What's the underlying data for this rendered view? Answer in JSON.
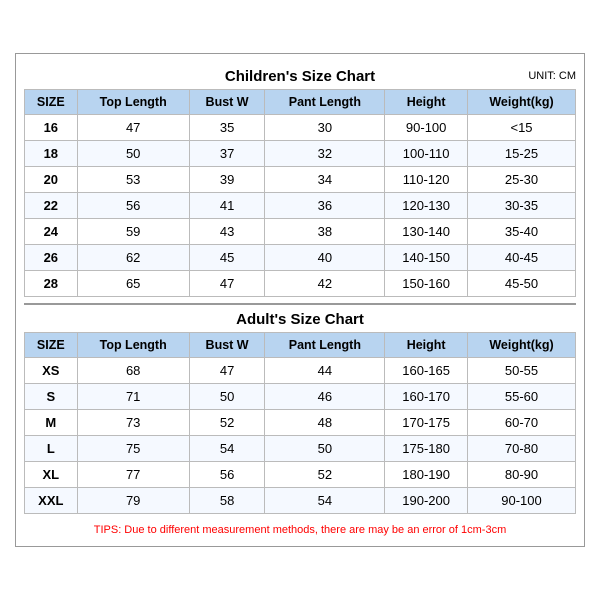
{
  "children": {
    "title": "Children's Size Chart",
    "unit": "UNIT: CM",
    "headers": [
      "SIZE",
      "Top Length",
      "Bust W",
      "Pant Length",
      "Height",
      "Weight(kg)"
    ],
    "rows": [
      [
        "16",
        "47",
        "35",
        "30",
        "90-100",
        "<15"
      ],
      [
        "18",
        "50",
        "37",
        "32",
        "100-110",
        "15-25"
      ],
      [
        "20",
        "53",
        "39",
        "34",
        "110-120",
        "25-30"
      ],
      [
        "22",
        "56",
        "41",
        "36",
        "120-130",
        "30-35"
      ],
      [
        "24",
        "59",
        "43",
        "38",
        "130-140",
        "35-40"
      ],
      [
        "26",
        "62",
        "45",
        "40",
        "140-150",
        "40-45"
      ],
      [
        "28",
        "65",
        "47",
        "42",
        "150-160",
        "45-50"
      ]
    ]
  },
  "adult": {
    "title": "Adult's Size Chart",
    "headers": [
      "SIZE",
      "Top Length",
      "Bust W",
      "Pant Length",
      "Height",
      "Weight(kg)"
    ],
    "rows": [
      [
        "XS",
        "68",
        "47",
        "44",
        "160-165",
        "50-55"
      ],
      [
        "S",
        "71",
        "50",
        "46",
        "160-170",
        "55-60"
      ],
      [
        "M",
        "73",
        "52",
        "48",
        "170-175",
        "60-70"
      ],
      [
        "L",
        "75",
        "54",
        "50",
        "175-180",
        "70-80"
      ],
      [
        "XL",
        "77",
        "56",
        "52",
        "180-190",
        "80-90"
      ],
      [
        "XXL",
        "79",
        "58",
        "54",
        "190-200",
        "90-100"
      ]
    ]
  },
  "tips": "TIPS: Due to different measurement methods, there are may be an error of 1cm-3cm"
}
